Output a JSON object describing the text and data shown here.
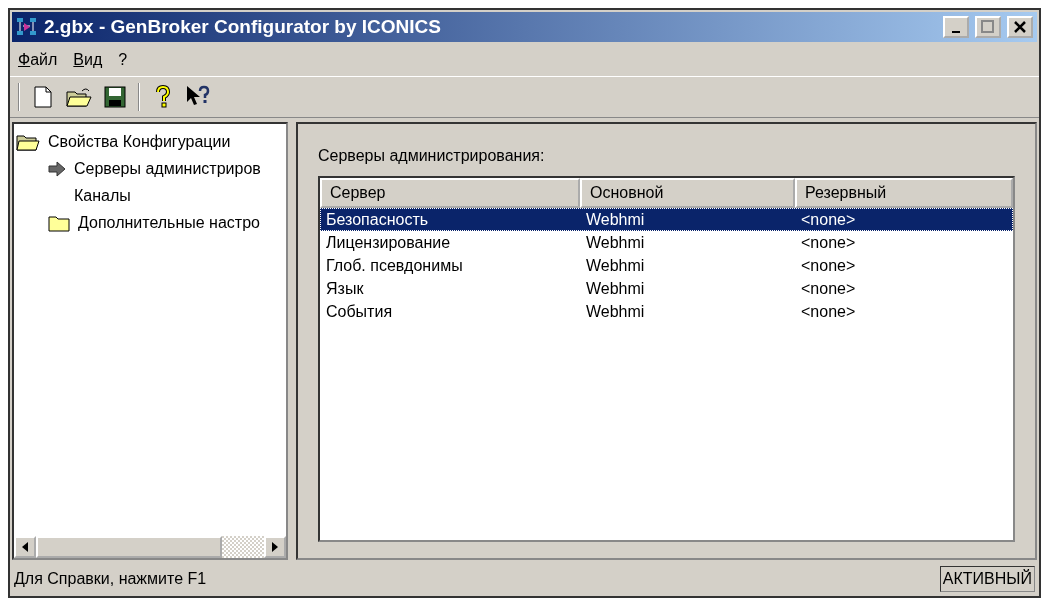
{
  "window": {
    "title": "2.gbx - GenBroker Configurator by ICONICS"
  },
  "menu": [
    "Файл",
    "Вид",
    "?"
  ],
  "tree": [
    {
      "label": "Свойства Конфигурации",
      "kind": "folder-open",
      "children": [
        {
          "label": "Серверы администриров",
          "kind": "arrow"
        },
        {
          "label": "Каналы",
          "kind": "none"
        },
        {
          "label": "Дополнительные настро",
          "kind": "folder"
        }
      ]
    }
  ],
  "panel": {
    "label": "Серверы администрирования:"
  },
  "table": {
    "columns": [
      "Сервер",
      "Основной",
      "Резервный"
    ],
    "rows": [
      {
        "cells": [
          "Безопасность",
          "Webhmi",
          "<none>"
        ],
        "selected": true
      },
      {
        "cells": [
          "Лицензирование",
          "Webhmi",
          "<none>"
        ],
        "selected": false
      },
      {
        "cells": [
          "Глоб. псевдонимы",
          "Webhmi",
          "<none>"
        ],
        "selected": false
      },
      {
        "cells": [
          "Язык",
          "Webhmi",
          "<none>"
        ],
        "selected": false
      },
      {
        "cells": [
          "События",
          "Webhmi",
          "<none>"
        ],
        "selected": false
      }
    ]
  },
  "status_bar": {
    "text": "Для Справки, нажмите F1",
    "indicator": "АКТИВНЫЙ"
  }
}
